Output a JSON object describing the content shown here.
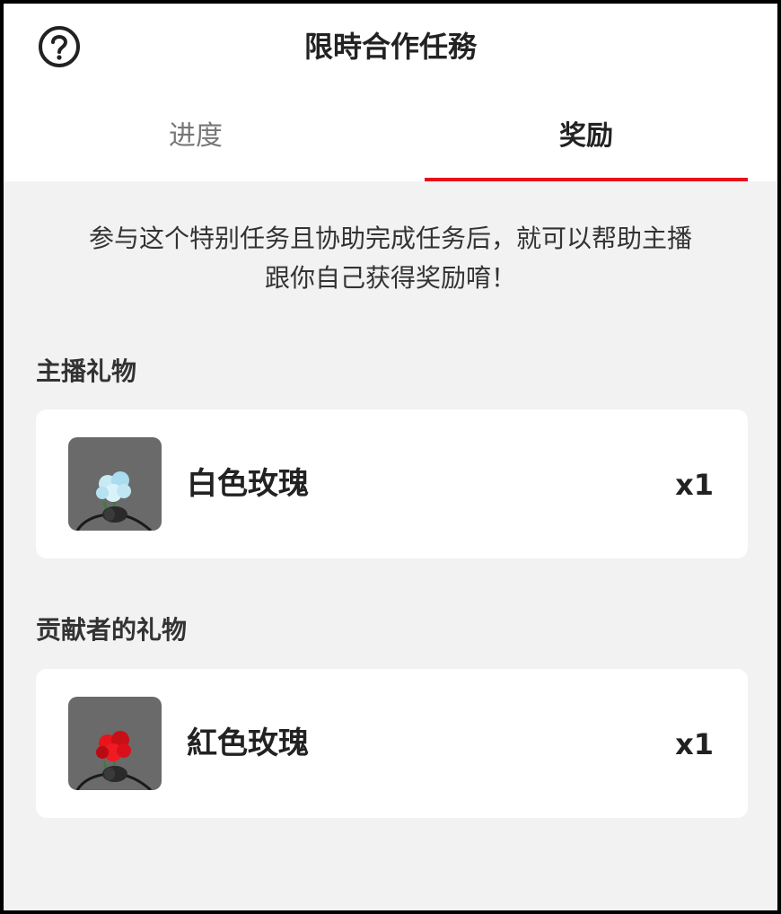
{
  "header": {
    "title": "限時合作任務",
    "help_icon": "question-circle-icon"
  },
  "tabs": [
    {
      "label": "进度",
      "active": false
    },
    {
      "label": "奖励",
      "active": true
    }
  ],
  "accent_color": "#e8101b",
  "description_lines": [
    "参与这个特别任务且协助完成任务后，就可以帮助主播",
    "跟你自己获得奖励唷！"
  ],
  "sections": [
    {
      "title": "主播礼物",
      "gift": {
        "name": "白色玫瑰",
        "quantity": "x1",
        "icon": "white-rose-icon",
        "color": "#bfe6f2"
      }
    },
    {
      "title": "贡献者的礼物",
      "gift": {
        "name": "紅色玫瑰",
        "quantity": "x1",
        "icon": "red-rose-icon",
        "color": "#e8141c"
      }
    }
  ]
}
